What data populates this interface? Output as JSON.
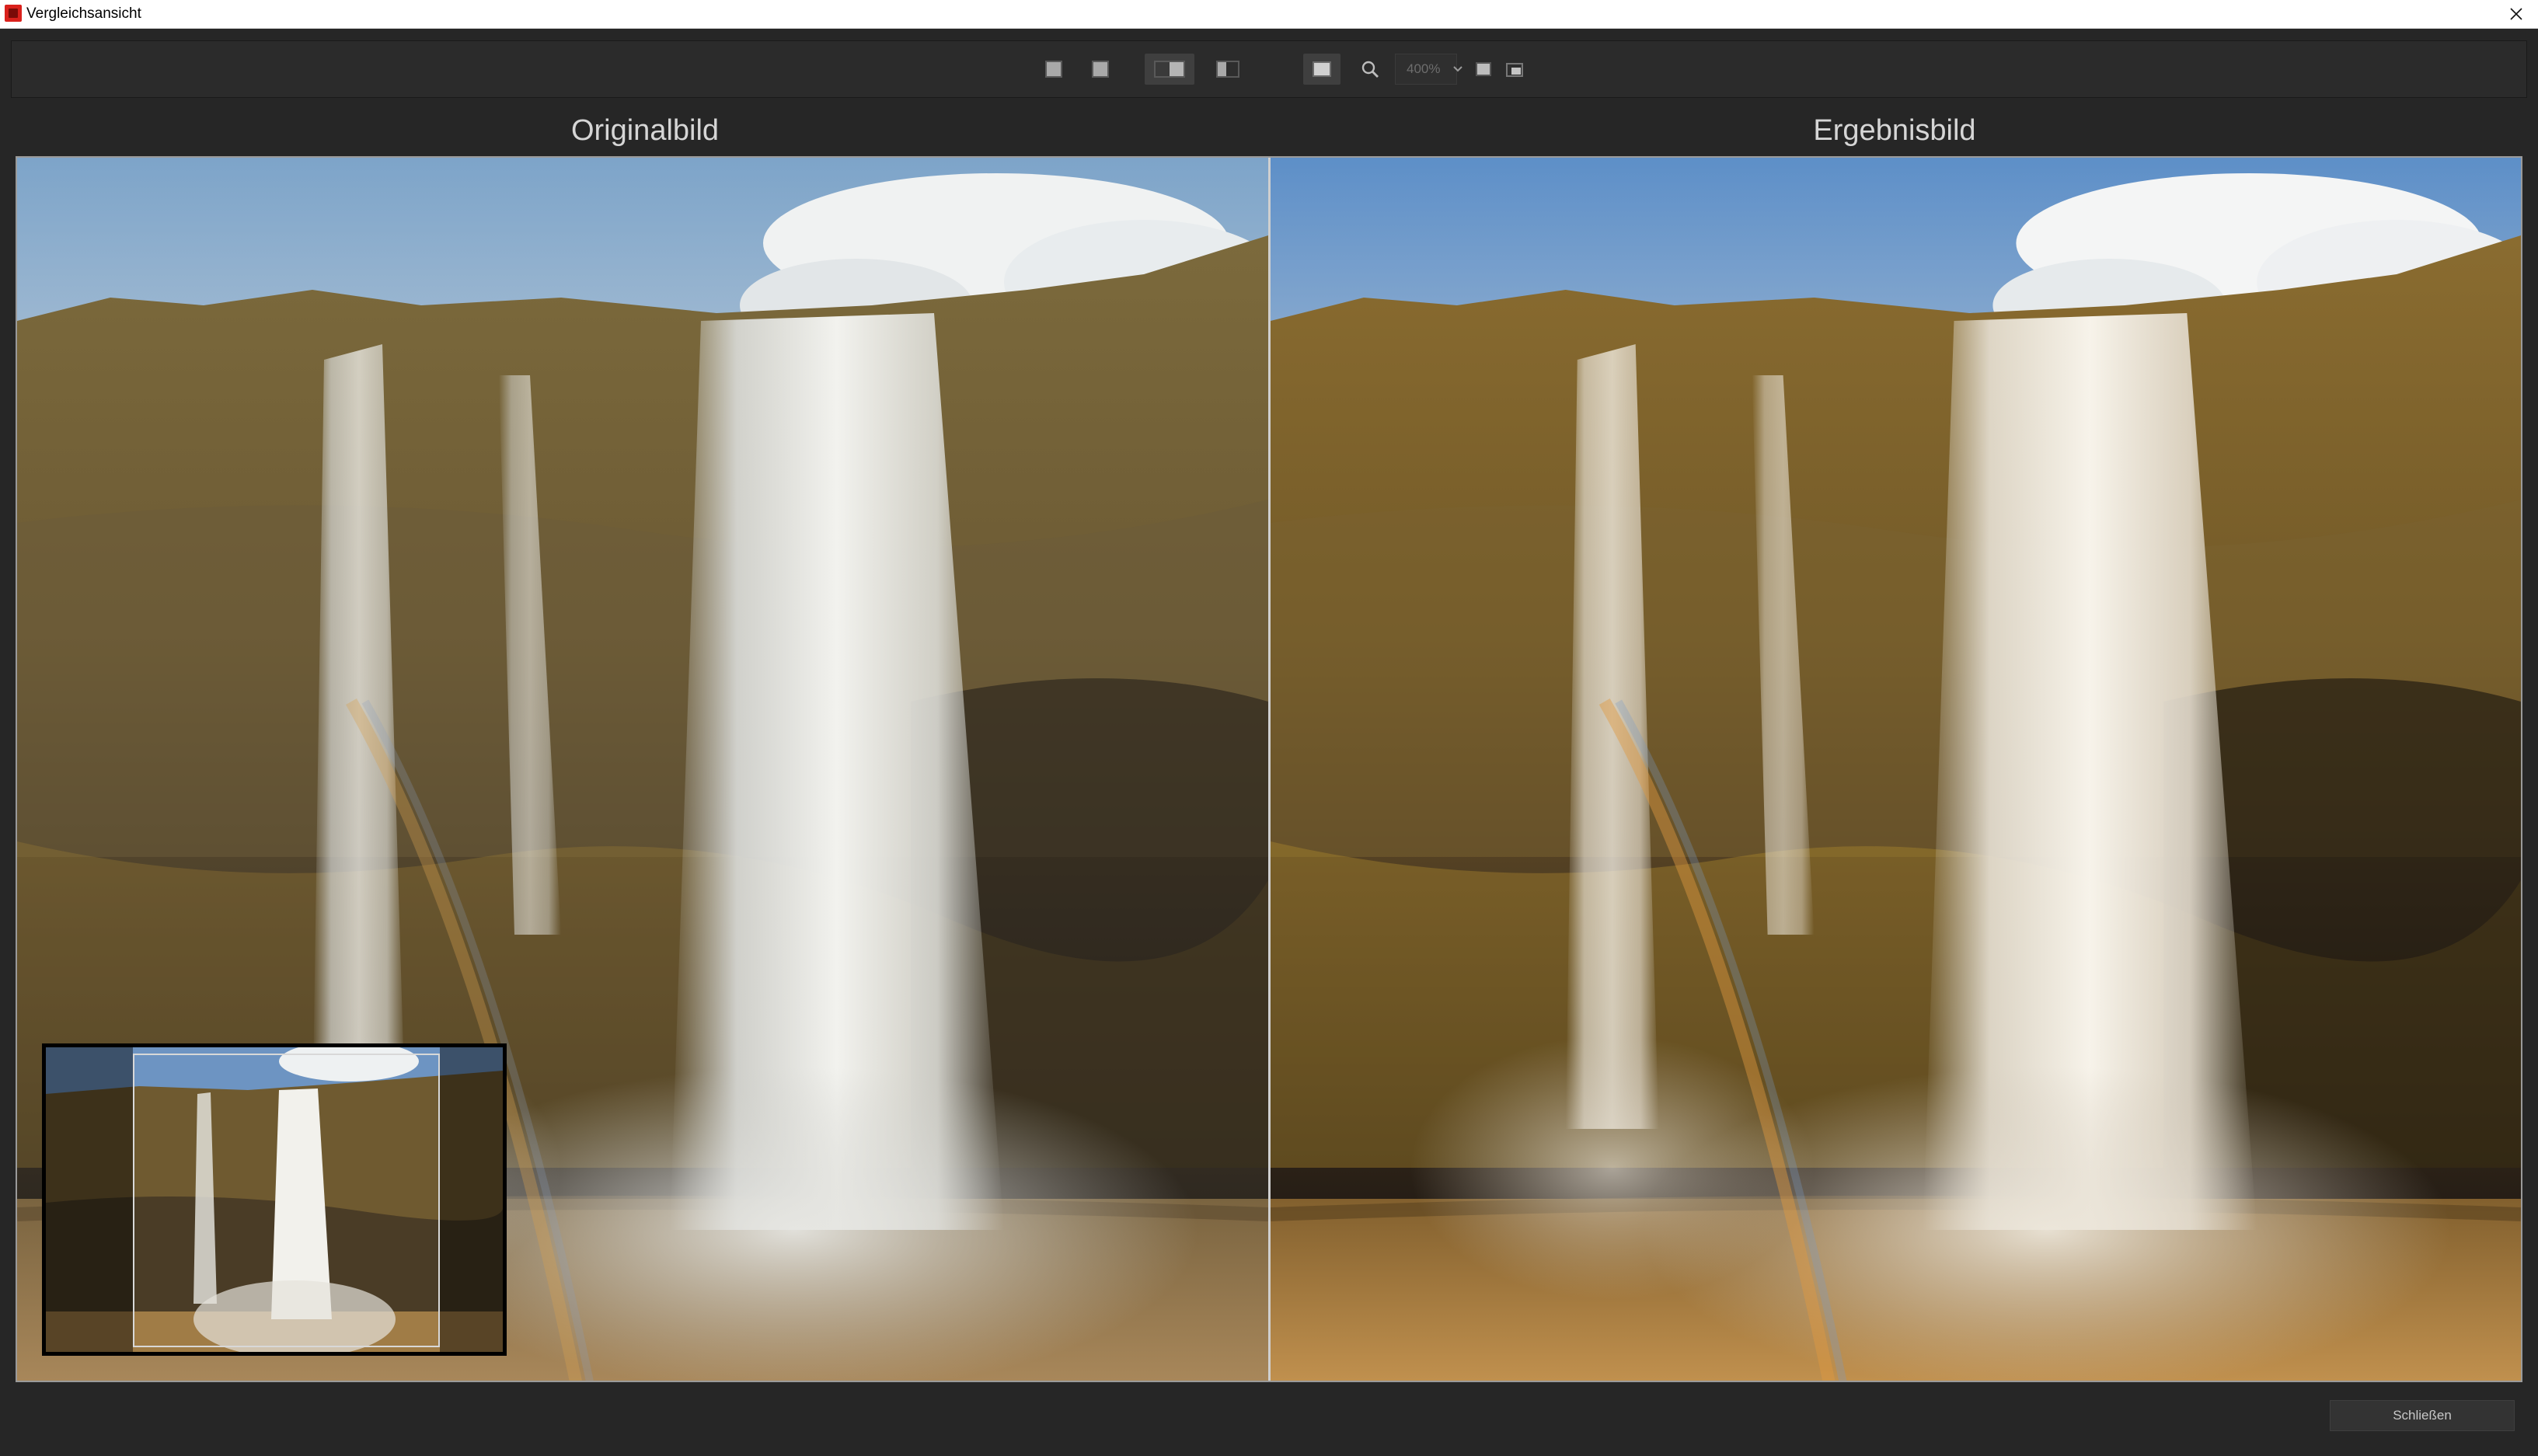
{
  "window": {
    "title": "Vergleichsansicht",
    "icon": "app-logo-icon",
    "close_icon": "close-icon"
  },
  "toolbar": {
    "view_modes": [
      {
        "name": "view-single-original",
        "icon": "single-view-icon",
        "active": false
      },
      {
        "name": "view-single-result",
        "icon": "single-view-icon",
        "active": false
      },
      {
        "name": "view-side-by-side",
        "icon": "side-by-side-icon",
        "active": true
      },
      {
        "name": "view-split",
        "icon": "split-view-icon",
        "active": false
      }
    ],
    "fit_icon": "fit-to-window-icon",
    "zoom_icon": "magnifier-icon",
    "zoom_value": "400%",
    "zoom_dropdown_icon": "chevron-down-icon",
    "actual_size_icon": "actual-size-icon",
    "navigator_icon": "navigator-toggle-icon"
  },
  "panels": {
    "left_caption": "Originalbild",
    "right_caption": "Ergebnisbild"
  },
  "footer": {
    "close_label": "Schließen"
  },
  "colors": {
    "background": "#262626",
    "toolbar": "#2b2b2b",
    "caption_text": "#d6d6d6",
    "app_icon": "#d9211c"
  }
}
